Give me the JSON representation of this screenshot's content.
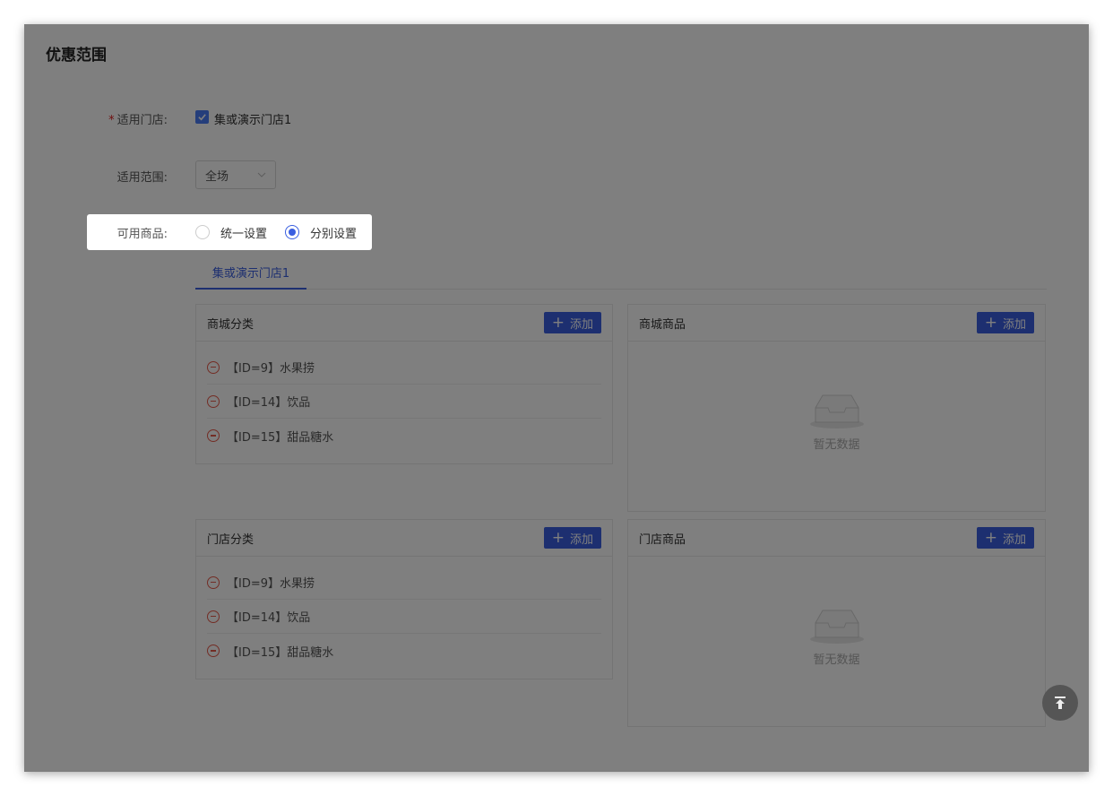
{
  "section_title": "优惠范围",
  "store_field": {
    "label": "适用门店:",
    "required_mark": "*",
    "option": "集或演示门店1"
  },
  "scope_field": {
    "label": "适用范围:",
    "value": "全场"
  },
  "goods_field": {
    "label": "可用商品:",
    "options": [
      {
        "label": "统一设置",
        "selected": false
      },
      {
        "label": "分别设置",
        "selected": true
      }
    ]
  },
  "tabs": [
    {
      "label": "集或演示门店1",
      "active": true
    }
  ],
  "panels": {
    "mall_category": {
      "title": "商城分类",
      "add_label": "添加",
      "items": [
        "【ID=9】水果捞",
        "【ID=14】饮品",
        "【ID=15】甜品糖水"
      ]
    },
    "mall_goods": {
      "title": "商城商品",
      "add_label": "添加",
      "empty_text": "暂无数据"
    },
    "store_category": {
      "title": "门店分类",
      "add_label": "添加",
      "items": [
        "【ID=9】水果捞",
        "【ID=14】饮品",
        "【ID=15】甜品糖水"
      ]
    },
    "store_goods": {
      "title": "门店商品",
      "add_label": "添加",
      "empty_text": "暂无数据"
    }
  },
  "colors": {
    "primary": "#3a5fe0",
    "remove": "#e65a4a",
    "required": "#e02020"
  }
}
